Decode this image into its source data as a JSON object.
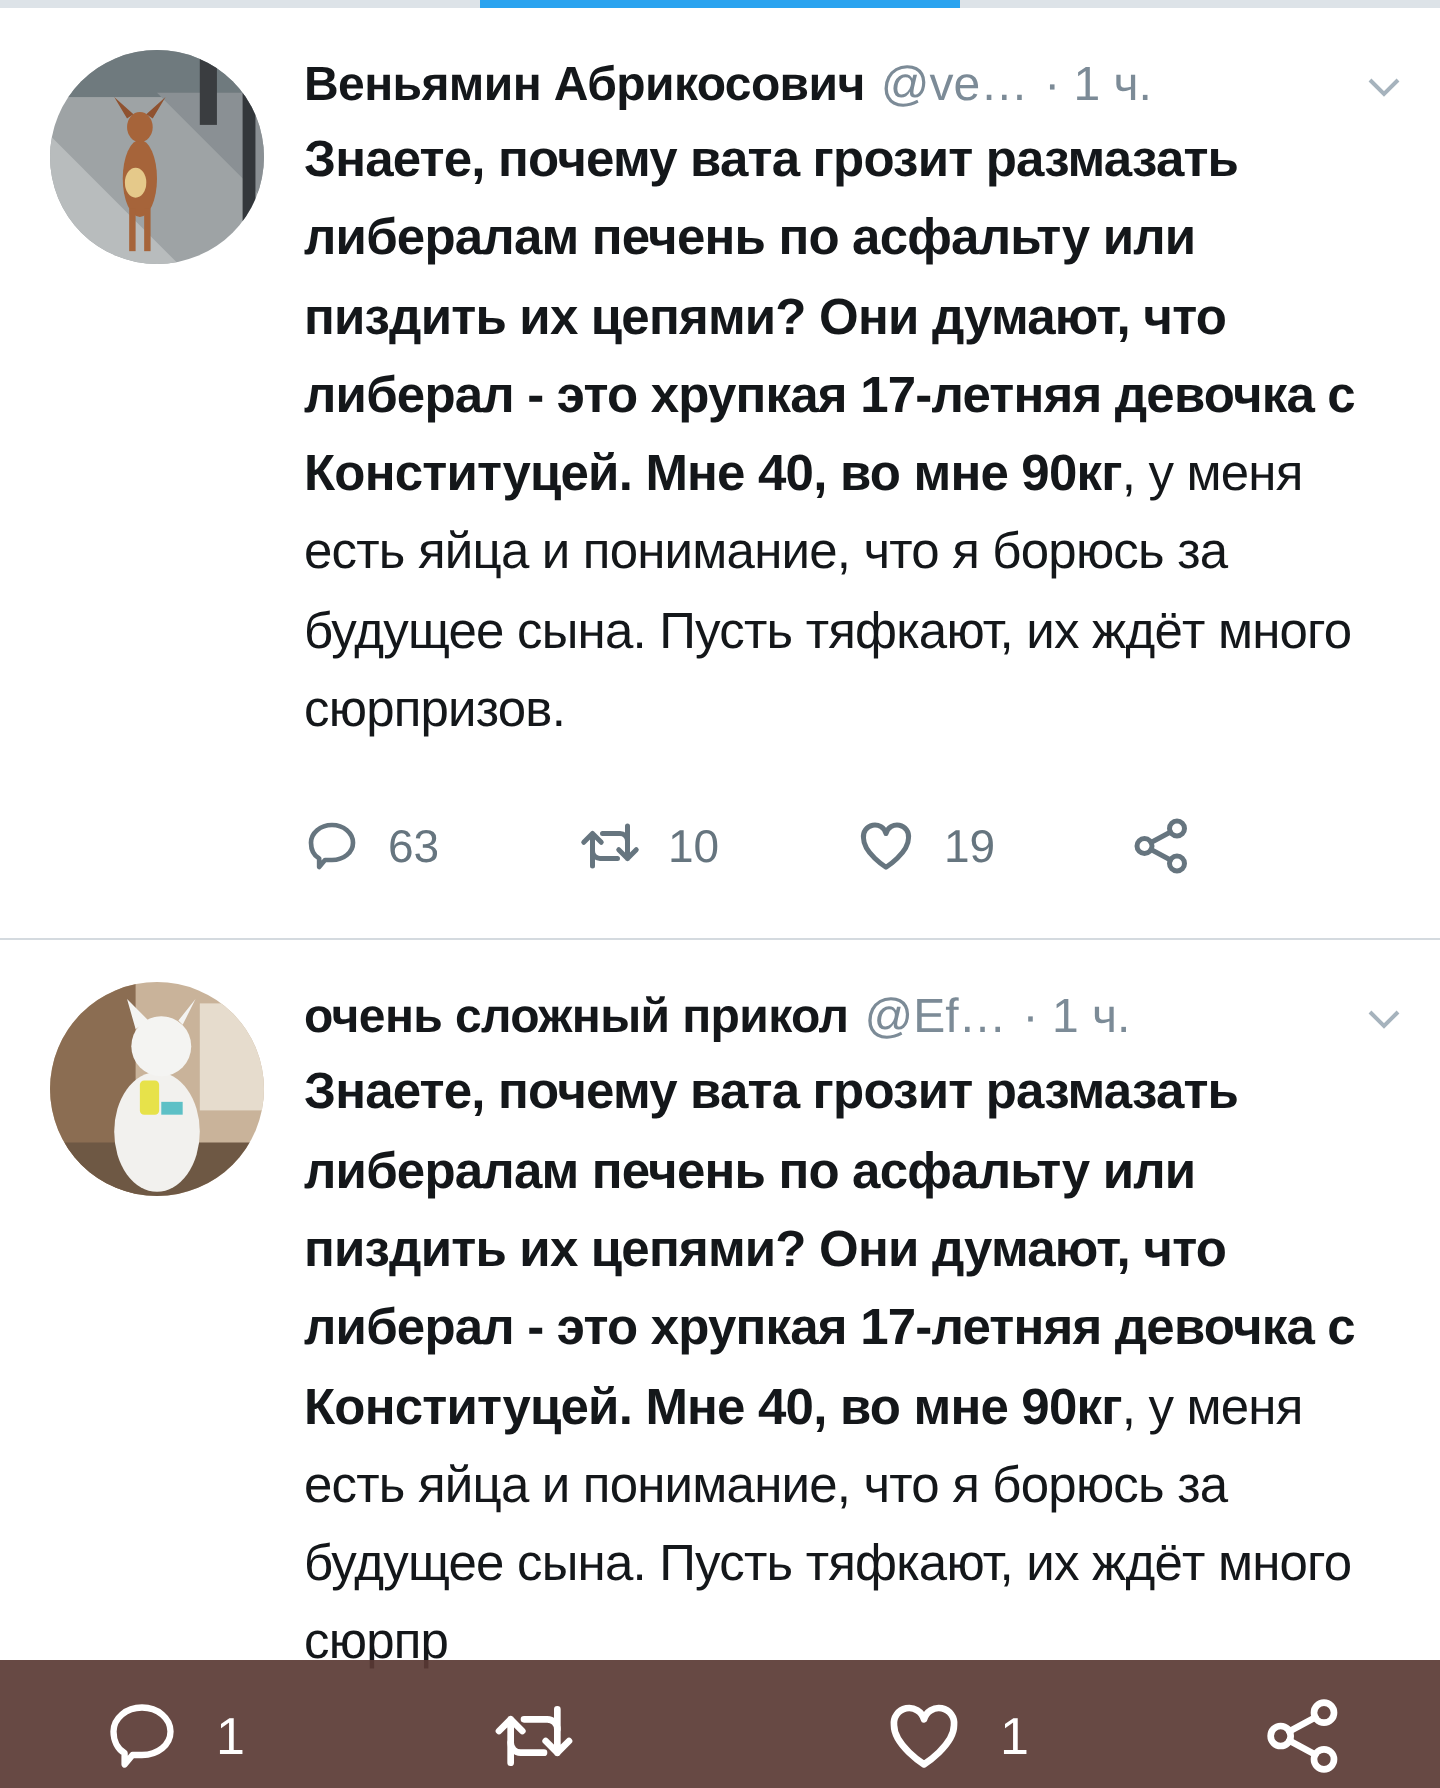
{
  "tabs_indicator": [
    {
      "selected": false
    },
    {
      "selected": true
    },
    {
      "selected": false
    }
  ],
  "tweets": [
    {
      "name": "Веньямин Абрикосович",
      "handle": "@ve…",
      "time": "· 1 ч.",
      "text": "**Знаете, почему вата грозит размазать либералам печень по асфальту или пиздить их цепями? Они думают, что либерал - это хрупкая 17-летняя девочка с Конституцей. Мне 40, во мне 90кг**, у меня есть яйца и понимание, что я борюсь за будущее сына. Пусть тяфкают, их ждёт много сюрпризов.",
      "actions": {
        "replies": "63",
        "retweets": "10",
        "likes": "19"
      }
    },
    {
      "name": "очень сложный прикол",
      "handle": "@Ef…",
      "time": "· 1 ч.",
      "text": "**Знаете, почему вата грозит размазать либералам печень по асфальту или пиздить их цепями? Они думают, что либерал - это хрупкая 17-летняя девочка с Конституцей. Мне 40, во мне 90кг**, у меня есть яйца и понимание, что я борюсь за будущее сына. Пусть тяфкают, их ждёт много сюрпр"
    }
  ],
  "overlay_actions": {
    "replies": "1",
    "likes": "1"
  }
}
